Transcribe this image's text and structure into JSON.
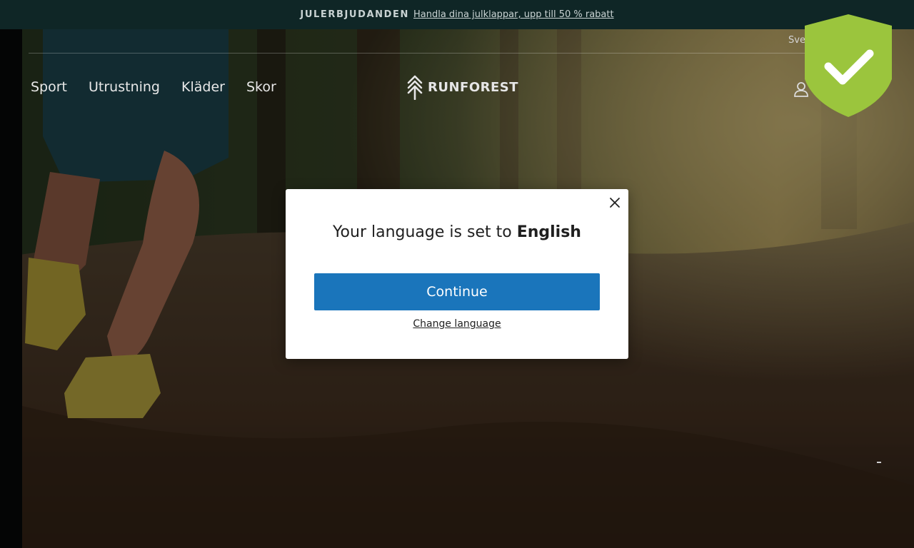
{
  "announcement": {
    "title": "JULERBJUDANDEN",
    "link_text": "Handla dina julklappar, upp till 50 % rabatt"
  },
  "header": {
    "language_label": "Sve",
    "nav": [
      {
        "label": "Sport"
      },
      {
        "label": "Utrustning"
      },
      {
        "label": "Kläder"
      },
      {
        "label": "Skor"
      }
    ],
    "logo_text": "RUNFOREST"
  },
  "modal": {
    "title_prefix": "Your language is set to",
    "title_language": "English",
    "continue_label": "Continue",
    "change_language_label": "Change language"
  },
  "colors": {
    "announcement_bg": "#0f2626",
    "accent_blue": "#1a75bb",
    "badge_green": "#9bc53d"
  },
  "icons": {
    "account": "user-icon",
    "close": "close-icon",
    "badge": "shield-check-icon",
    "logo": "tree-logo-icon"
  }
}
